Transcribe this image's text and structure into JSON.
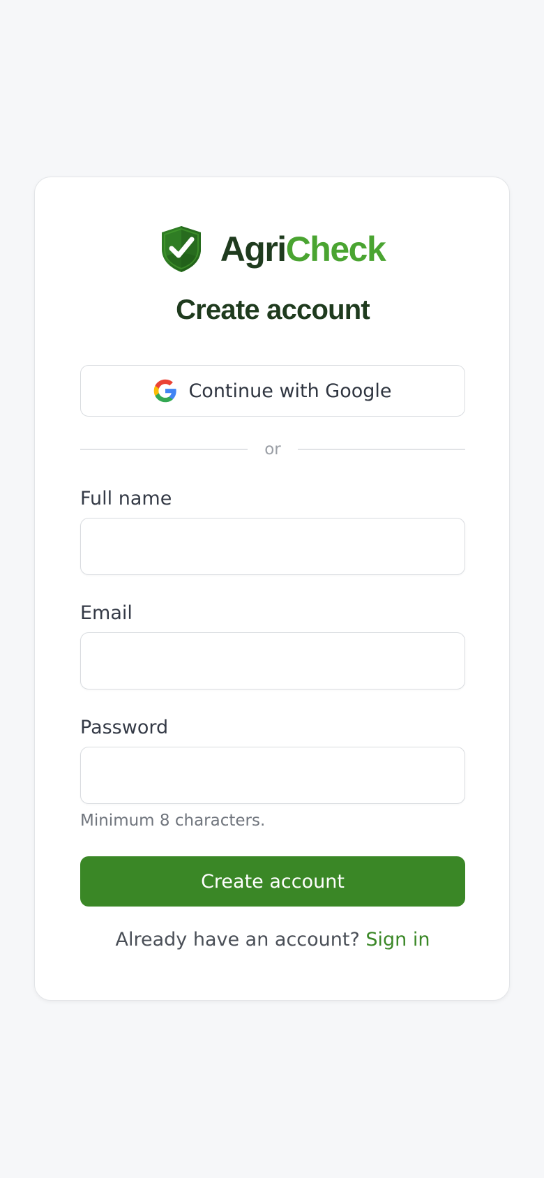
{
  "brand": {
    "name_part1": "Agri",
    "name_part2": "Check",
    "logo_icon": "shield-check-icon",
    "colors": {
      "dark_green": "#1f3b1e",
      "light_green": "#4aa431",
      "shield": "#2f7d24"
    }
  },
  "page": {
    "title": "Create account",
    "background": "#f6f7f9"
  },
  "google_button": {
    "label": "Continue with Google",
    "icon": "google-icon"
  },
  "divider": {
    "text": "or"
  },
  "form": {
    "full_name": {
      "label": "Full name",
      "value": "",
      "placeholder": ""
    },
    "email": {
      "label": "Email",
      "value": "",
      "placeholder": ""
    },
    "password": {
      "label": "Password",
      "value": "",
      "placeholder": "",
      "hint": "Minimum 8 characters."
    }
  },
  "submit": {
    "label": "Create account",
    "color": "#3a8726"
  },
  "footer": {
    "prompt": "Already have an account?",
    "link_label": "Sign in"
  }
}
